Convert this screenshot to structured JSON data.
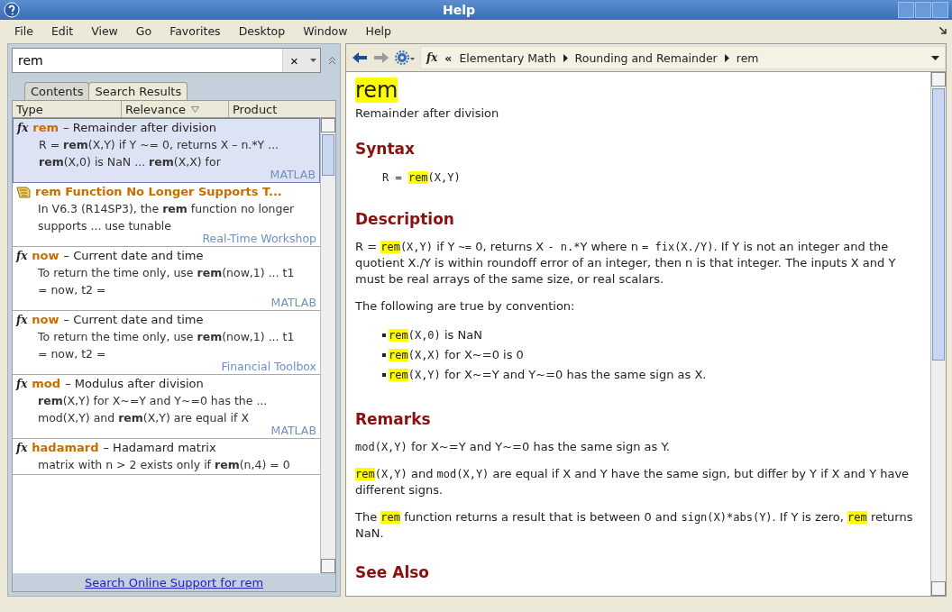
{
  "window": {
    "title": "Help"
  },
  "menu": [
    {
      "label": "File"
    },
    {
      "label": "Edit"
    },
    {
      "label": "View"
    },
    {
      "label": "Go"
    },
    {
      "label": "Favorites"
    },
    {
      "label": "Desktop"
    },
    {
      "label": "Window"
    },
    {
      "label": "Help"
    }
  ],
  "search": {
    "value": "rem",
    "clear_glyph": "×"
  },
  "tabs": [
    {
      "label": "Contents",
      "selected": false
    },
    {
      "label": "Search Results",
      "selected": true
    }
  ],
  "columns": [
    {
      "label": "Type",
      "sorted": false
    },
    {
      "label": "Relevance",
      "sorted": true
    },
    {
      "label": "Product",
      "sorted": false
    }
  ],
  "results": [
    {
      "kind": "function",
      "glyph": "fx",
      "name": "rem",
      "summary": "– Remainder after division",
      "snippet": "R = **rem**(X,Y) if Y ~= 0, returns X – n.*Y ... **rem**(X,0) is NaN ... **rem**(X,X) for",
      "product": "MATLAB",
      "selected": true
    },
    {
      "kind": "document",
      "name": "rem Function No Longer Supports T...",
      "snippet": "In V6.3 (R14SP3), the **rem** function no longer supports ... use tunable",
      "product": "Real-Time Workshop",
      "selected": false
    },
    {
      "kind": "function",
      "glyph": "fx",
      "name": "now",
      "summary": "– Current date and time",
      "snippet": "To return the time only, use **rem**(now,1) ... t1 = now, t2 =",
      "product": "MATLAB",
      "selected": false
    },
    {
      "kind": "function",
      "glyph": "fx",
      "name": "now",
      "summary": "– Current date and time",
      "snippet": "To return the time only, use **rem**(now,1) ... t1 = now, t2 =",
      "product": "Financial Toolbox",
      "selected": false
    },
    {
      "kind": "function",
      "glyph": "fx",
      "name": "mod",
      "summary": "– Modulus after division",
      "snippet": "**rem**(X,Y) for X~=Y and Y~=0 has the ... mod(X,Y) and **rem**(X,Y) are equal if X",
      "product": "MATLAB",
      "selected": false
    },
    {
      "kind": "function",
      "glyph": "fx",
      "name": "hadamard",
      "summary": "– Hadamard matrix",
      "snippet": "matrix with n > 2 exists only if **rem**(n,4) = 0",
      "selected": false
    }
  ],
  "online_link": "Search Online Support for rem",
  "breadcrumb": {
    "glyph": "fx",
    "back_glyph": "«",
    "items": [
      "Elementary Math",
      "Rounding and Remainder",
      "rem"
    ]
  },
  "doc": {
    "title": "rem",
    "title_highlighted": true,
    "subtitle": "Remainder after division",
    "sections": [
      {
        "heading": "Syntax",
        "blocks": [
          {
            "kind": "code_line",
            "segments": [
              {
                "kind": "code",
                "text": "R = "
              },
              {
                "kind": "match",
                "text": "rem"
              },
              {
                "kind": "code",
                "text": "(X,Y)"
              }
            ]
          }
        ]
      },
      {
        "heading": "Description",
        "blocks": [
          {
            "kind": "paragraph",
            "segments": [
              {
                "kind": "text",
                "text": "R = "
              },
              {
                "kind": "match",
                "text": "rem"
              },
              {
                "kind": "code",
                "text": "(X,Y)"
              },
              {
                "kind": "text",
                "text": " if Y "
              },
              {
                "kind": "code",
                "text": "~="
              },
              {
                "kind": "text",
                "text": " 0, returns X "
              },
              {
                "kind": "code",
                "text": "- n.*"
              },
              {
                "kind": "text",
                "text": "Y where n "
              },
              {
                "kind": "code",
                "text": "= fix(X./Y)"
              },
              {
                "kind": "text",
                "text": ". If Y is not an integer and the quotient X./Y is within roundoff error of an integer, then n is that integer. The inputs X and Y must be real arrays of the same size, or real scalars."
              }
            ]
          },
          {
            "kind": "paragraph",
            "segments": [
              {
                "kind": "text",
                "text": "The following are true by convention:"
              }
            ]
          },
          {
            "kind": "bullets",
            "items": [
              [
                {
                  "kind": "match",
                  "text": "rem"
                },
                {
                  "kind": "code",
                  "text": "(X,0)"
                },
                {
                  "kind": "text",
                  "text": " is NaN"
                }
              ],
              [
                {
                  "kind": "match",
                  "text": "rem"
                },
                {
                  "kind": "code",
                  "text": "(X,X)"
                },
                {
                  "kind": "text",
                  "text": " for X~=0 is 0"
                }
              ],
              [
                {
                  "kind": "match",
                  "text": "rem"
                },
                {
                  "kind": "code",
                  "text": "(X,Y)"
                },
                {
                  "kind": "text",
                  "text": " for X~=Y and Y~=0 has the same sign as X."
                }
              ]
            ]
          }
        ]
      },
      {
        "heading": "Remarks",
        "blocks": [
          {
            "kind": "paragraph",
            "segments": [
              {
                "kind": "code",
                "text": "mod(X,Y)"
              },
              {
                "kind": "text",
                "text": " for X~=Y and Y~=0 has the same sign as Y."
              }
            ]
          },
          {
            "kind": "paragraph",
            "segments": [
              {
                "kind": "match",
                "text": "rem"
              },
              {
                "kind": "code",
                "text": "(X,Y)"
              },
              {
                "kind": "text",
                "text": " and "
              },
              {
                "kind": "code",
                "text": "mod(X,Y)"
              },
              {
                "kind": "text",
                "text": " are equal if X and Y have the same sign, but differ by Y if X and Y have different signs."
              }
            ]
          },
          {
            "kind": "paragraph",
            "segments": [
              {
                "kind": "text",
                "text": "The "
              },
              {
                "kind": "match",
                "text": "rem"
              },
              {
                "kind": "text",
                "text": " function returns a result that is between 0 and "
              },
              {
                "kind": "code",
                "text": "sign(X)*abs(Y)"
              },
              {
                "kind": "text",
                "text": ". If Y is zero, "
              },
              {
                "kind": "match",
                "text": "rem"
              },
              {
                "kind": "text",
                "text": " returns NaN."
              }
            ]
          }
        ]
      },
      {
        "heading": "See Also"
      }
    ]
  }
}
